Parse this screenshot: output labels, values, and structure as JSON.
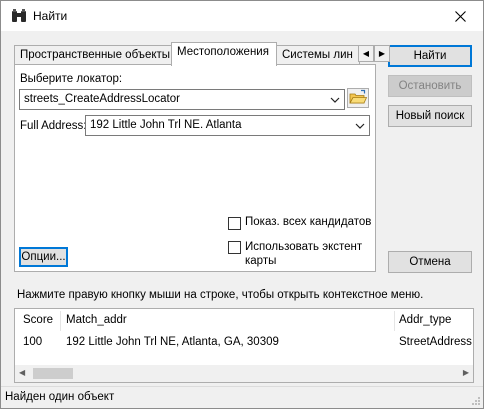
{
  "window": {
    "title": "Найти",
    "icon": "binoculars-icon"
  },
  "tabs": [
    {
      "label": "Пространственные объекты",
      "active": false
    },
    {
      "label": "Местоположения",
      "active": true
    },
    {
      "label": "Системы лин",
      "active": false
    }
  ],
  "locator": {
    "label": "Выберите локатор:",
    "value": "streets_CreateAddressLocator"
  },
  "address": {
    "label": "Full Address:",
    "value": "192 Little John Trl NE. Atlanta"
  },
  "options_button": "Опции...",
  "checkboxes": {
    "show_all": {
      "label": "Показ. всех кандидатов",
      "checked": false
    },
    "use_extent": {
      "label": "Использовать экстент карты",
      "checked": false
    }
  },
  "buttons": {
    "find": "Найти",
    "stop": "Остановить",
    "new_search": "Новый поиск",
    "cancel": "Отмена"
  },
  "hint": "Нажмите правую кнопку мыши на строке, чтобы открыть контекстное меню.",
  "results": {
    "columns": [
      "Score",
      "Match_addr",
      "Addr_type"
    ],
    "rows": [
      [
        "100",
        "192 Little John Trl NE, Atlanta, GA, 30309",
        "StreetAddress"
      ]
    ]
  },
  "status": "Найден один объект"
}
